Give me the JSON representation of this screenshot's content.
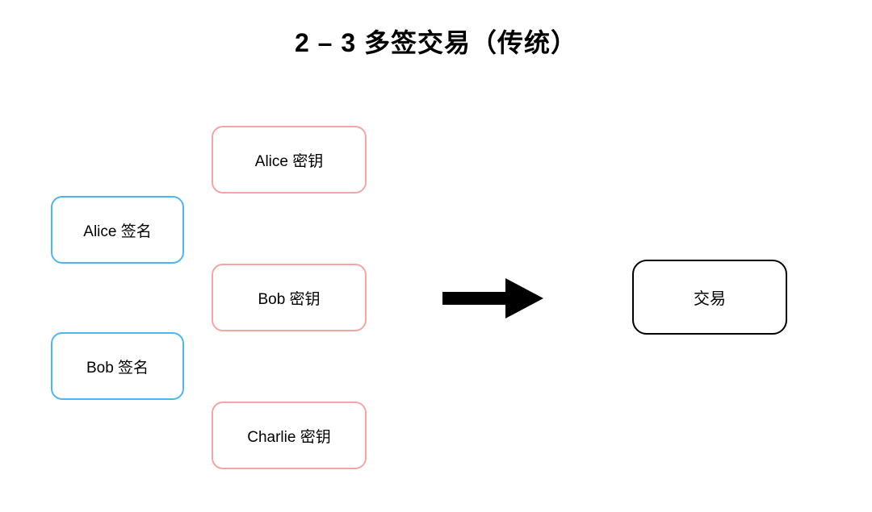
{
  "title": "2 – 3 多签交易（传统）",
  "signatures": {
    "alice": "Alice 签名",
    "bob": "Bob 签名"
  },
  "keys": {
    "alice": "Alice 密钥",
    "bob": "Bob 密钥",
    "charlie": "Charlie 密钥"
  },
  "transaction": "交易",
  "colors": {
    "blue": "#4fb5f2",
    "pink": "#f5a5a5",
    "black": "#000000"
  }
}
